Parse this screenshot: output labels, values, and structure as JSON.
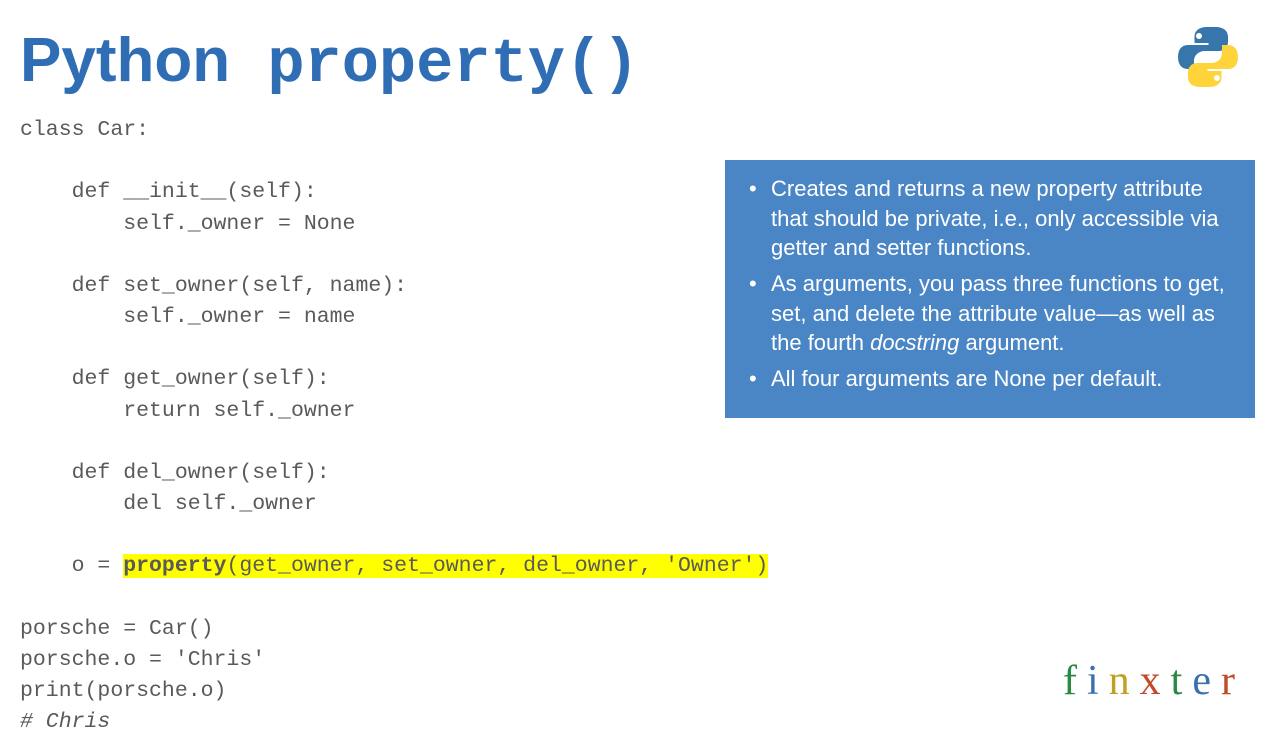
{
  "title": {
    "part1": "Python",
    "part2": " property()"
  },
  "code": {
    "l1": "class Car:",
    "l2": "",
    "l3": "    def __init__(self):",
    "l4": "        self._owner = None",
    "l5": "",
    "l6": "    def set_owner(self, name):",
    "l7": "        self._owner = name",
    "l8": "",
    "l9": "    def get_owner(self):",
    "l10": "        return self._owner",
    "l11": "",
    "l12": "    def del_owner(self):",
    "l13": "        del self._owner",
    "l14": "",
    "l15a": "    o = ",
    "l15b": "property",
    "l15c": "(get_owner, set_owner, del_owner, 'Owner')",
    "l16": "",
    "l17": "porsche = Car()",
    "l18": "porsche.o = 'Chris'",
    "l19": "print(porsche.o)",
    "l20": "# Chris"
  },
  "callout": {
    "items": [
      "Creates and returns a new property attribute that should be private, i.e., only accessible via getter and setter functions.",
      "As arguments, you pass three functions to get, set, and delete the attribute value—as well as the fourth <em>docstring</em> argument.",
      "All four arguments are None per default."
    ]
  },
  "brand": {
    "letters": [
      "f",
      "i",
      "n",
      "x",
      "t",
      "e",
      "r"
    ]
  }
}
